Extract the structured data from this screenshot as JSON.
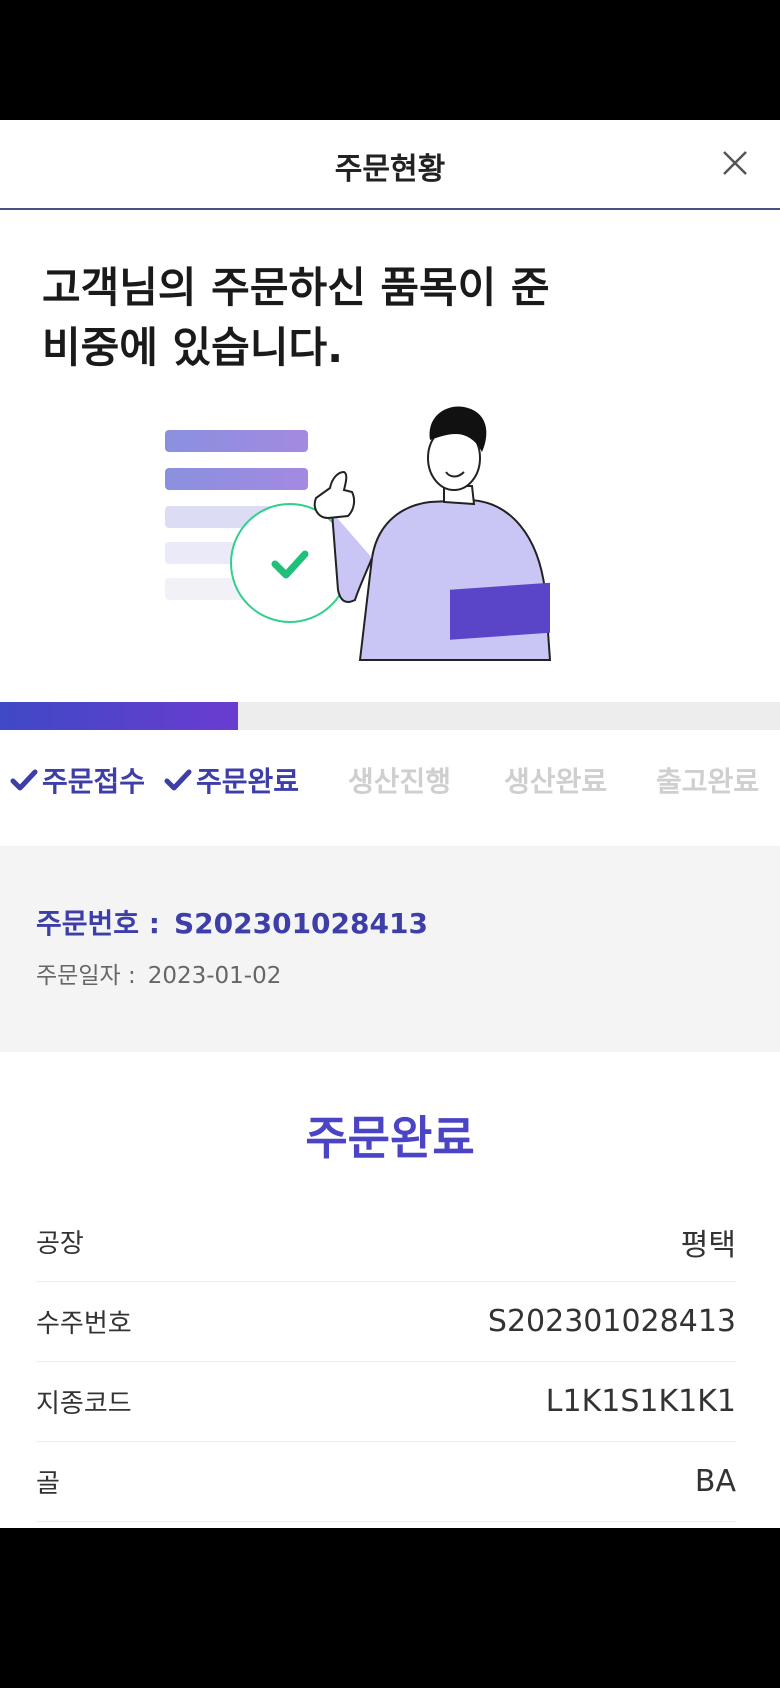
{
  "header": {
    "title": "주문현황"
  },
  "headline": {
    "line1": "고객님의 주문하신 품목이 준",
    "line2": "비중에 있습니다."
  },
  "progress": {
    "fraction": 0.305
  },
  "steps": [
    {
      "label": "주문접수",
      "done": true
    },
    {
      "label": "주문완료",
      "done": true
    },
    {
      "label": "생산진행",
      "done": false
    },
    {
      "label": "생산완료",
      "done": false
    },
    {
      "label": "출고완료",
      "done": false
    }
  ],
  "order": {
    "number_label": "주문번호 :",
    "number_value": "S202301028413",
    "date_label": "주문일자 :",
    "date_value": "2023-01-02"
  },
  "status_title": "주문완료",
  "details": [
    {
      "label": "공장",
      "value": "평택"
    },
    {
      "label": "수주번호",
      "value": "S202301028413"
    },
    {
      "label": "지종코드",
      "value": "L1K1S1K1K1"
    },
    {
      "label": "골",
      "value": "BA"
    }
  ],
  "colors": {
    "accent": "#3d3ea8",
    "status_title": "#4b45c6",
    "progress_start": "#3f49c6",
    "progress_end": "#6a3cd0",
    "inactive_step": "#cfcfcf",
    "check_circle": "#2fd08a"
  },
  "icons": {
    "close": "close-icon",
    "step_check": "check-icon"
  }
}
